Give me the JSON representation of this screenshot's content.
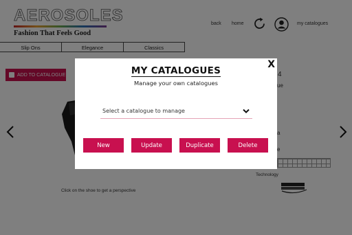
{
  "brand": {
    "name": "AEROSOLES",
    "tagline": "Fashion That Feels Good"
  },
  "header": {
    "back_label": "back",
    "home_label": "home",
    "catalogues_label": "my catalogues",
    "refresh_icon": "refresh-icon",
    "user_icon": "user-icon"
  },
  "tabs": [
    {
      "label": "Slip Ons"
    },
    {
      "label": "Elegance"
    },
    {
      "label": "Classics"
    }
  ],
  "product": {
    "add_button_label": "ADD TO CATALOGUE",
    "perspective_hint": "Click on the shoe to get a perspective",
    "technology_label": "Technology",
    "fragment_1": "4",
    "fragment_2": "ue",
    "fragment_3": "a",
    "fragment_4": "e"
  },
  "modal": {
    "close_label": "X",
    "title": "MY CATALOGUES",
    "subtitle": "Manage your own catalogues",
    "select_placeholder": "Select a catalogue to manage",
    "buttons": {
      "new": "New",
      "update": "Update",
      "duplicate": "Duplicate",
      "delete": "Delete"
    }
  },
  "colors": {
    "accent": "#c8104f",
    "select_underline": "#e5a3b6",
    "overlay": "rgba(0,0,0,0.5)"
  }
}
